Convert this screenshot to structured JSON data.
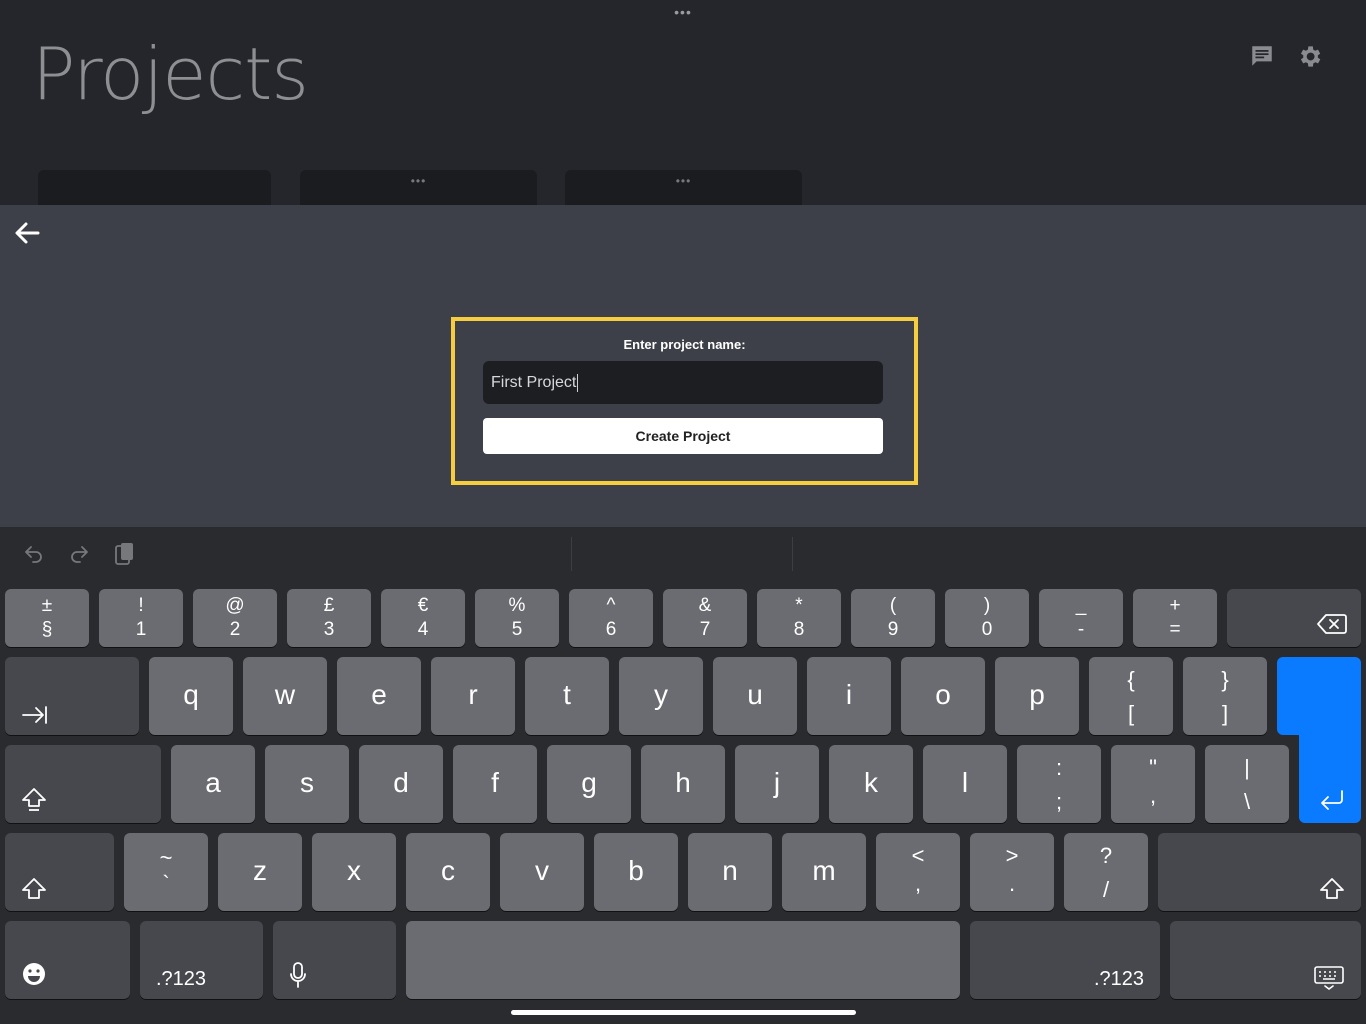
{
  "app": {
    "top_dots": "•••",
    "page_title": "Projects",
    "header_icons": [
      "message-icon",
      "gear-icon"
    ],
    "card_dots": "•••"
  },
  "form": {
    "label": "Enter project name:",
    "input_value": "First Project",
    "submit_label": "Create Project",
    "highlight_color": "#f6cd3e"
  },
  "keyboard": {
    "row1": [
      {
        "top": "±",
        "bot": "§"
      },
      {
        "top": "!",
        "bot": "1"
      },
      {
        "top": "@",
        "bot": "2"
      },
      {
        "top": "£",
        "bot": "3"
      },
      {
        "top": "€",
        "bot": "4"
      },
      {
        "top": "%",
        "bot": "5"
      },
      {
        "top": "^",
        "bot": "6"
      },
      {
        "top": "&",
        "bot": "7"
      },
      {
        "top": "*",
        "bot": "8"
      },
      {
        "top": "(",
        "bot": "9"
      },
      {
        "top": ")",
        "bot": "0"
      },
      {
        "top": "_",
        "bot": "-"
      },
      {
        "top": "+",
        "bot": "="
      }
    ],
    "row2": [
      "q",
      "w",
      "e",
      "r",
      "t",
      "y",
      "u",
      "i",
      "o",
      "p"
    ],
    "row2_brackets": [
      {
        "top": "{",
        "bot": "["
      },
      {
        "top": "}",
        "bot": "]"
      }
    ],
    "row3": [
      "a",
      "s",
      "d",
      "f",
      "g",
      "h",
      "j",
      "k",
      "l"
    ],
    "row3_punct": [
      {
        "top": ":",
        "bot": ";"
      },
      {
        "top": "\"",
        "bot": ","
      },
      {
        "top": "|",
        "bot": "\\"
      }
    ],
    "row4_tilde": {
      "top": "~",
      "bot": "`"
    },
    "row4": [
      "z",
      "x",
      "c",
      "v",
      "b",
      "n",
      "m"
    ],
    "row4_punct": [
      {
        "top": "<",
        "bot": ","
      },
      {
        "top": ">",
        "bot": "."
      },
      {
        "top": "?",
        "bot": "/"
      }
    ],
    "numbers_label": ".?123",
    "return_color": "#0a7aff"
  }
}
